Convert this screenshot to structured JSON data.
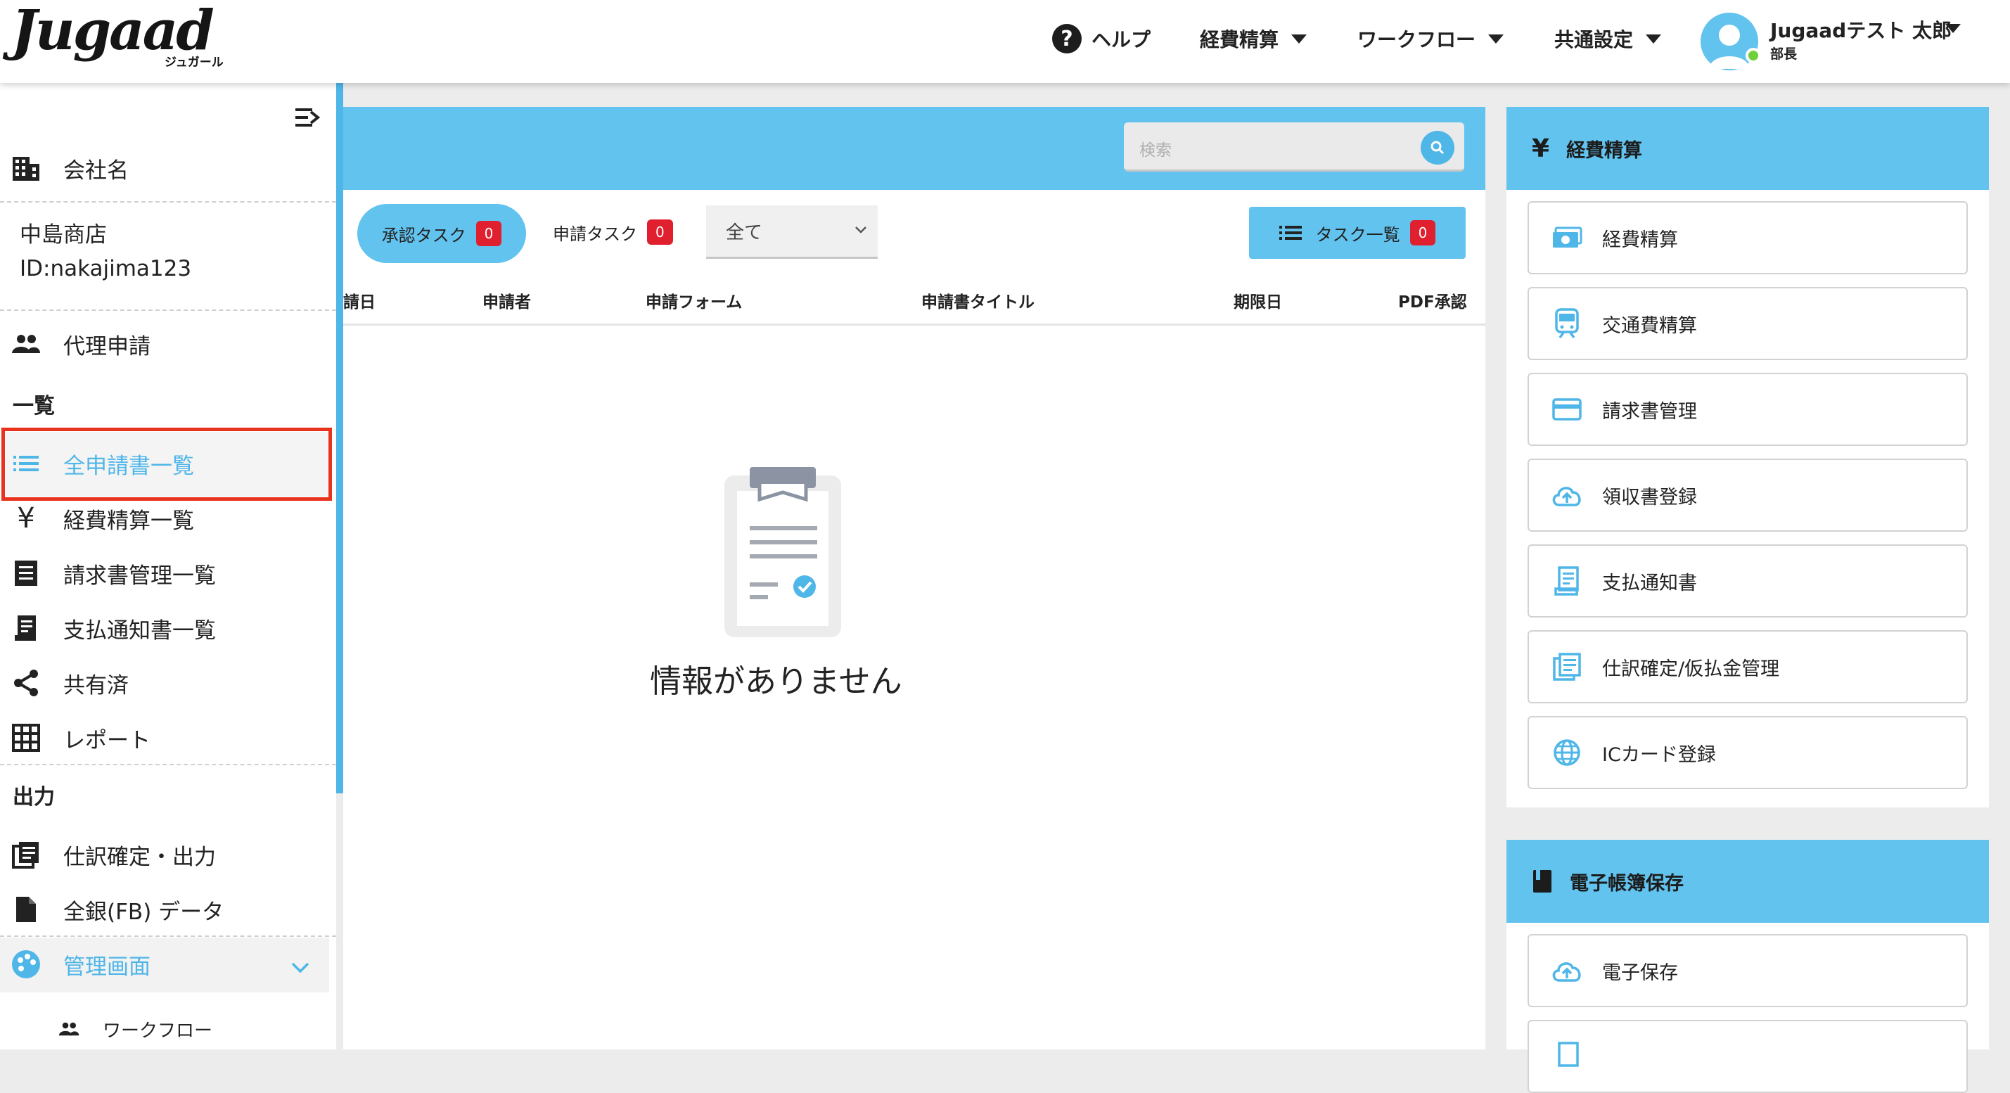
{
  "header": {
    "logo": "Jugaad",
    "logo_sub": "ジュガール",
    "help": "ヘルプ",
    "nav": [
      "経費精算",
      "ワークフロー",
      "共通設定"
    ],
    "user_name": "Jugaadテスト 太郎",
    "user_role": "部長"
  },
  "sidebar": {
    "company_label": "会社名",
    "company_name": "中島商店",
    "company_id": "ID:nakajima123",
    "proxy": "代理申請",
    "list_heading": "一覧",
    "list_items": [
      "全申請書一覧",
      "経費精算一覧",
      "請求書管理一覧",
      "支払通知書一覧",
      "共有済",
      "レポート"
    ],
    "output_heading": "出力",
    "output_items": [
      "仕訳確定・出力",
      "全銀(FB) データ"
    ],
    "admin": "管理画面",
    "workflow": "ワークフロー"
  },
  "main": {
    "search_placeholder": "検索",
    "tab_approval": "承認タスク",
    "tab_approval_count": "0",
    "tab_request": "申請タスク",
    "tab_request_count": "0",
    "filter_value": "全て",
    "task_list_label": "タスク一覧",
    "task_list_count": "0",
    "columns": [
      "請日",
      "申請者",
      "申請フォーム",
      "申請書タイトル",
      "期限日",
      "PDF承認"
    ],
    "empty_message": "情報がありません"
  },
  "right": {
    "expense_title": "経費精算",
    "expense_items": [
      "経費精算",
      "交通費精算",
      "請求書管理",
      "領収書登録",
      "支払通知書",
      "仕訳確定/仮払金管理",
      "ICカード登録"
    ],
    "ebook_title": "電子帳簿保存",
    "ebook_items": [
      "電子保存"
    ]
  },
  "colors": {
    "accent": "#62c3ef",
    "badge": "#e0202e",
    "highlight": "#e8321e",
    "status": "#6fcf3a"
  }
}
